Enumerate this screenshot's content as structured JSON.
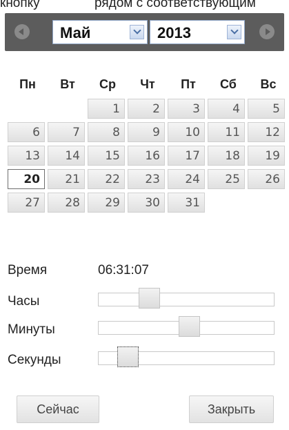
{
  "top_text": {
    "left": "кнопку",
    "right": "рядом с соответствующим"
  },
  "navigation": {
    "prev_icon": "chevron-left-icon",
    "next_icon": "chevron-right-icon"
  },
  "month_select": {
    "value": "Май"
  },
  "year_select": {
    "value": "2013"
  },
  "weekdays": [
    "Пн",
    "Вт",
    "Ср",
    "Чт",
    "Пт",
    "Сб",
    "Вс"
  ],
  "weeks": [
    [
      "",
      "",
      "1",
      "2",
      "3",
      "4",
      "5"
    ],
    [
      "6",
      "7",
      "8",
      "9",
      "10",
      "11",
      "12"
    ],
    [
      "13",
      "14",
      "15",
      "16",
      "17",
      "18",
      "19"
    ],
    [
      "20",
      "21",
      "22",
      "23",
      "24",
      "25",
      "26"
    ],
    [
      "27",
      "28",
      "29",
      "30",
      "31",
      "",
      ""
    ]
  ],
  "today": "20",
  "time": {
    "label": "Время",
    "value": "06:31:07"
  },
  "sliders": {
    "hours": {
      "label": "Часы",
      "level": 0.26
    },
    "minutes": {
      "label": "Минуты",
      "level": 0.52
    },
    "seconds": {
      "label": "Секунды",
      "level": 0.12
    }
  },
  "buttons": {
    "now": "Сейчас",
    "close": "Закрыть"
  }
}
